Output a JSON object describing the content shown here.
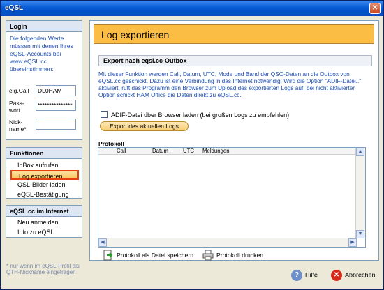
{
  "window": {
    "title": "eQSL"
  },
  "login": {
    "heading": "Login",
    "info": "Die folgenden Werte müssen mit denen Ihres eQSL-Accounts bei www.eQSL.cc übereinstimmen:",
    "call_label": "eig.Call",
    "call_value": "DL0HAM",
    "pass_label": "Pass-wort",
    "pass_value": "***************",
    "nick_label": "Nick-name*",
    "nick_value": ""
  },
  "functions": {
    "heading": "Funktionen",
    "items": [
      "InBox aufrufen",
      "Log exportieren",
      "QSL-Bilder laden",
      "eQSL-Bestätigung"
    ]
  },
  "internet": {
    "heading": "eQSL.cc im Internet",
    "items": [
      "Neu anmelden",
      "Info zu eQSL"
    ]
  },
  "footnote": "* nur wenn im eQSL-Profil als QTH-Nickname eingetragen",
  "main": {
    "heading": "Log exportieren",
    "section_title": "Export nach eqsl.cc-Outbox",
    "description": "Mit dieser Funktion werden Call, Datum, UTC, Mode und Band der QSO-Daten an die Outbox von eQSL.cc geschickt. Dazu ist eine Verbindung in das Internet notwendig. Wird die Option \"ADIF-Datei..\" aktiviert, ruft das Programm den Browser zum Upload des exportierten Logs auf, bei nicht aktivierter Option schickt HAM Office die Daten direkt zu eQSL.cc.",
    "checkbox_label": "ADIF-Datei über Browser laden (bei großen Logs zu empfehlen)",
    "export_button": "Export des aktuellen Logs",
    "protocol_label": "Protokoll",
    "columns": [
      "Call",
      "Datum",
      "UTC",
      "Meldungen"
    ]
  },
  "actions": {
    "save_protocol": "Protokoll als Datei speichern",
    "print_protocol": "Protokoll drucken",
    "help": "Hilfe",
    "cancel": "Abbrechen"
  },
  "colors": {
    "accent_header": "#fbbd43",
    "active_border": "#e64010",
    "info_text": "#1c4fb4"
  }
}
